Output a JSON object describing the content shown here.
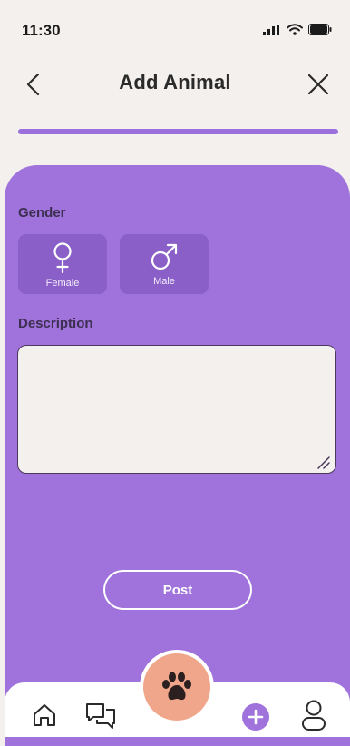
{
  "status_bar": {
    "time": "11:30"
  },
  "header": {
    "title": "Add Animal"
  },
  "progress": {
    "value": 1.0
  },
  "form": {
    "gender_label": "Gender",
    "gender_options": [
      {
        "label": "Female",
        "icon": "female-symbol-icon"
      },
      {
        "label": "Male",
        "icon": "male-symbol-icon"
      }
    ],
    "description_label": "Description",
    "description_value": "",
    "post_label": "Post"
  },
  "nav": {
    "items": [
      "home-icon",
      "chat-icon",
      "paw-icon",
      "add-icon",
      "profile-icon"
    ]
  },
  "colors": {
    "accent": "#9f73db",
    "paw_button": "#f0a68b",
    "background": "#f4f0ee"
  }
}
